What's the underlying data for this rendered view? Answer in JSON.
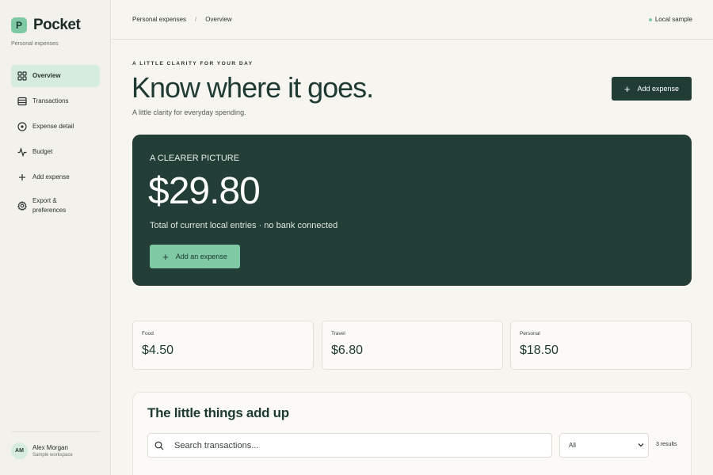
{
  "brand": {
    "mark": "P",
    "name": "Pocket",
    "subtitle": "Personal expenses"
  },
  "sidebar": {
    "items": [
      {
        "label": "Overview",
        "icon": "grid-icon",
        "active": true
      },
      {
        "label": "Transactions",
        "icon": "list-icon"
      },
      {
        "label": "Expense detail",
        "icon": "circle-info-icon"
      },
      {
        "label": "Budget",
        "icon": "pulse-icon"
      },
      {
        "label": "Add expense",
        "icon": "plus-icon"
      },
      {
        "label": "Export & preferences",
        "icon": "gear-icon"
      }
    ]
  },
  "user": {
    "initials": "AM",
    "name": "Alex Morgan",
    "workspace": "Sample workspace"
  },
  "topbar": {
    "breadcrumb": [
      "Personal expenses",
      "Overview"
    ],
    "status": "Local sample"
  },
  "header": {
    "eyebrow": "A LITTLE CLARITY FOR YOUR DAY",
    "title": "Know where it goes.",
    "subtitle": "A little clarity for everyday spending.",
    "add_button": "Add expense"
  },
  "hero": {
    "kicker": "A CLEARER PICTURE",
    "amount": "$29.80",
    "caption": "Total of current local entries · no bank connected",
    "button": "Add an expense"
  },
  "categories": [
    {
      "name": "Food",
      "value": "$4.50"
    },
    {
      "name": "Travel",
      "value": "$6.80"
    },
    {
      "name": "Personal",
      "value": "$18.50"
    }
  ],
  "transactions": {
    "title": "The little things add up",
    "search_placeholder": "Search transactions...",
    "filter_value": "All",
    "results": "3 results"
  },
  "colors": {
    "accent": "#7fc9a4",
    "dark": "#233e37",
    "active_nav": "#d6ecdf",
    "background": "#f7f5f0"
  }
}
